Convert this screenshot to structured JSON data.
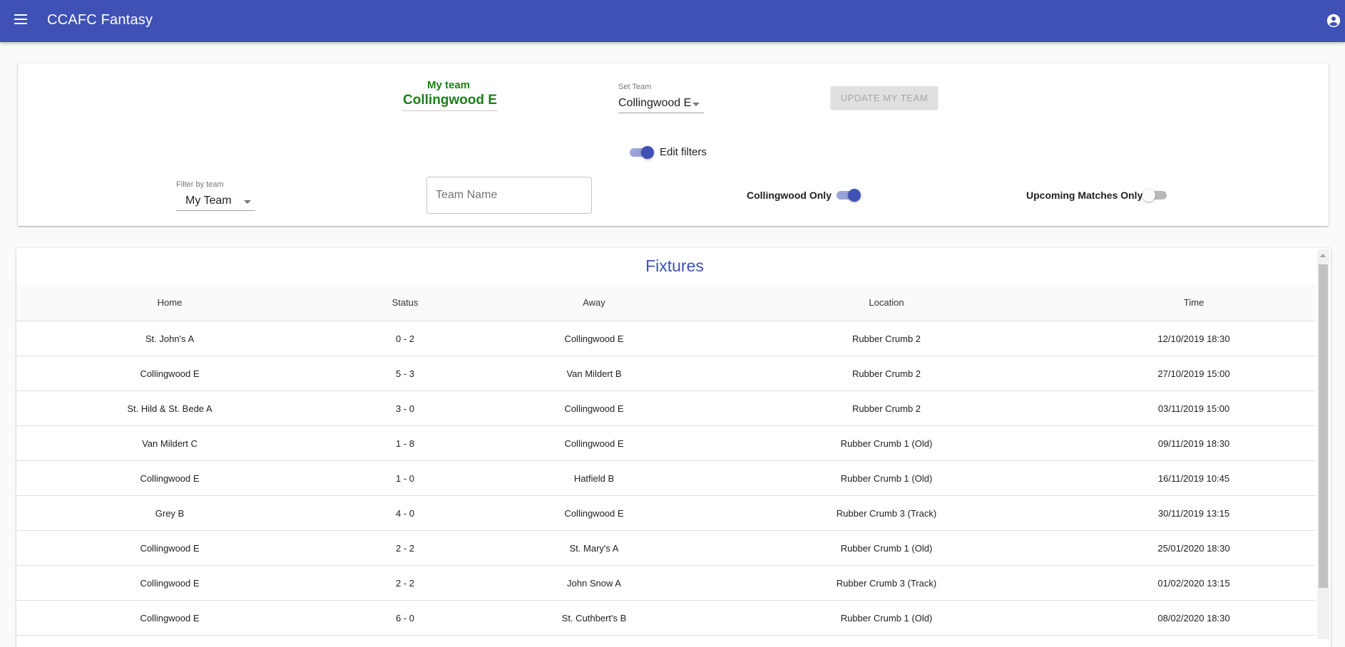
{
  "app": {
    "title": "CCAFC Fantasy"
  },
  "team_panel": {
    "my_team_label": "My team",
    "my_team_name": "Collingwood E",
    "set_team_label": "Set Team",
    "set_team_value": "Collingwood E",
    "update_button": "UPDATE MY TEAM",
    "edit_filters_label": "Edit filters",
    "edit_filters_on": true
  },
  "filters": {
    "filter_by_team_label": "Filter by team",
    "filter_by_team_value": "My Team",
    "team_name_placeholder": "Team Name",
    "collingwood_only_label": "Collingwood Only",
    "collingwood_only_on": true,
    "upcoming_only_label": "Upcoming Matches Only",
    "upcoming_only_on": false
  },
  "fixtures": {
    "title": "Fixtures",
    "columns": [
      "Home",
      "Status",
      "Away",
      "Location",
      "Time"
    ],
    "rows": [
      [
        "St. John's A",
        "0 - 2",
        "Collingwood E",
        "Rubber Crumb 2",
        "12/10/2019 18:30"
      ],
      [
        "Collingwood E",
        "5 - 3",
        "Van Mildert B",
        "Rubber Crumb 2",
        "27/10/2019 15:00"
      ],
      [
        "St. Hild & St. Bede A",
        "3 - 0",
        "Collingwood E",
        "Rubber Crumb 2",
        "03/11/2019 15:00"
      ],
      [
        "Van Mildert C",
        "1 - 8",
        "Collingwood E",
        "Rubber Crumb 1 (Old)",
        "09/11/2019 18:30"
      ],
      [
        "Collingwood E",
        "1 - 0",
        "Hatfield B",
        "Rubber Crumb 1 (Old)",
        "16/11/2019 10:45"
      ],
      [
        "Grey B",
        "4 - 0",
        "Collingwood E",
        "Rubber Crumb 3 (Track)",
        "30/11/2019 13:15"
      ],
      [
        "Collingwood E",
        "2 - 2",
        "St. Mary's A",
        "Rubber Crumb 1 (Old)",
        "25/01/2020 18:30"
      ],
      [
        "Collingwood E",
        "2 - 2",
        "John Snow A",
        "Rubber Crumb 3 (Track)",
        "01/02/2020 13:15"
      ],
      [
        "Collingwood E",
        "6 - 0",
        "St. Cuthbert's B",
        "Rubber Crumb 1 (Old)",
        "08/02/2020 18:30"
      ]
    ]
  },
  "colors": {
    "primary": "#3f51b5",
    "team_green": "#1b7f1b"
  },
  "icons": {
    "menu": "menu-icon",
    "account": "account-circle-icon"
  }
}
